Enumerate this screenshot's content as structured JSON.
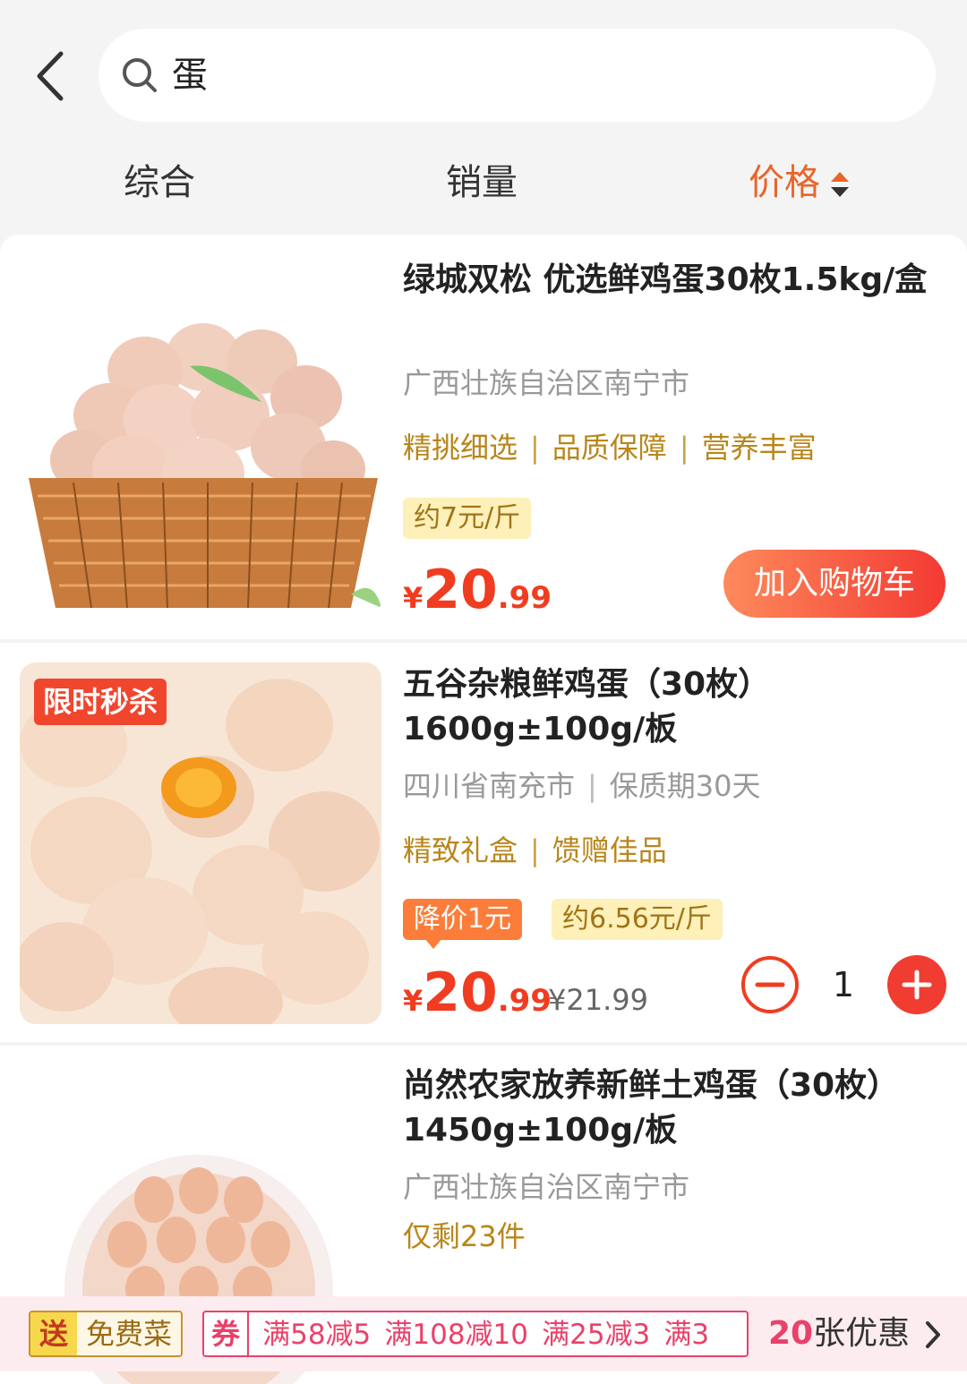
{
  "search": {
    "query": "蛋"
  },
  "tabs": [
    {
      "label": "综合"
    },
    {
      "label": "销量"
    },
    {
      "label": "价格"
    }
  ],
  "colors": {
    "accent": "#e8652a",
    "price": "#f03c20",
    "tag": "#b8861b",
    "cart_start": "#fd8a5b",
    "cart_end": "#f33a33"
  },
  "products": [
    {
      "title": "绿城双松 优选鲜鸡蛋30枚1.5kg/盒",
      "location": "广西壮族自治区南宁市",
      "tags": [
        "精挑细选",
        "品质保障",
        "营养丰富"
      ],
      "unit_price": "约7元/斤",
      "price": {
        "currency": "¥",
        "int": "20",
        "dec": ".99"
      },
      "cart_label": "加入购物车"
    },
    {
      "badge": "限时秒杀",
      "title": "五谷杂粮鲜鸡蛋（30枚）1600g±100g/板",
      "location": "四川省南充市",
      "shelf_life": "保质期30天",
      "tags": [
        "精致礼盒",
        "馈赠佳品"
      ],
      "price_drop": "降价1元",
      "unit_price": "约6.56元/斤",
      "price": {
        "currency": "¥",
        "int": "20",
        "dec": ".99"
      },
      "original_price": "¥21.99",
      "quantity": "1"
    },
    {
      "title": "尚然农家放养新鲜土鸡蛋（30枚）1450g±100g/板",
      "location": "广西壮族自治区南宁市",
      "stock": "仅剩23件"
    }
  ],
  "promo": {
    "gift_tag": "送",
    "gift_label": "免费菜",
    "coupon_tag": "券",
    "coupons": [
      "满58减5",
      "满108减10",
      "满25减3",
      "满3"
    ],
    "coupon_count": "20",
    "coupon_suffix": "张优惠"
  }
}
